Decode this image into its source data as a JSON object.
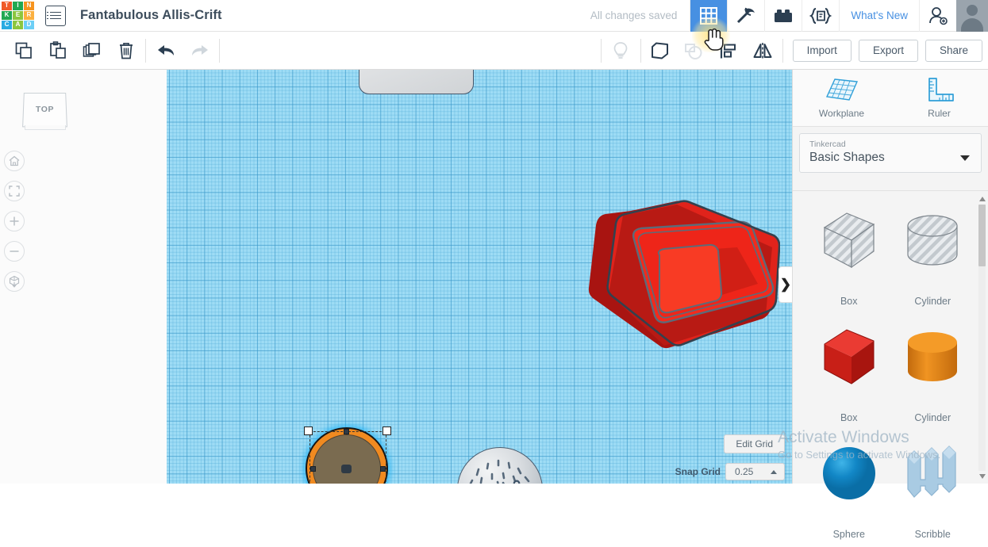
{
  "app": {
    "logo_letters": [
      "T",
      "I",
      "N",
      "K",
      "E",
      "R",
      "C",
      "A",
      "D"
    ],
    "logo_colors": [
      "#f05a28",
      "#22a852",
      "#f7941e",
      "#22a852",
      "#8cc63f",
      "#fbb040",
      "#29abe2",
      "#8cc63f",
      "#6dcff6"
    ],
    "project_title": "Fantabulous Allis-Crift",
    "menu_icon": "hamburger-list-icon"
  },
  "topbar": {
    "save_status": "All changes saved",
    "icons": [
      {
        "name": "blocks-grid-icon",
        "active": true
      },
      {
        "name": "pickaxe-minecraft-icon",
        "active": false
      },
      {
        "name": "lego-brick-icon",
        "active": false
      },
      {
        "name": "codeblocks-icon",
        "active": false
      }
    ],
    "whats_new": "What's New",
    "invite_icon": "add-person-icon",
    "avatar_icon": "user-avatar"
  },
  "toolbar": {
    "left_icons": [
      {
        "name": "copy-icon",
        "enabled": true
      },
      {
        "name": "paste-icon",
        "enabled": true
      },
      {
        "name": "duplicate-icon",
        "enabled": true
      },
      {
        "name": "delete-trash-icon",
        "enabled": true
      },
      {
        "name": "undo-icon",
        "enabled": true
      },
      {
        "name": "redo-icon",
        "enabled": false
      }
    ],
    "right_icons": [
      {
        "name": "lightbulb-icon",
        "enabled": false
      },
      {
        "name": "group-icon",
        "enabled": true
      },
      {
        "name": "ungroup-icon",
        "enabled": false
      },
      {
        "name": "align-icon",
        "enabled": true
      },
      {
        "name": "mirror-icon",
        "enabled": true
      }
    ],
    "import_label": "Import",
    "export_label": "Export",
    "share_label": "Share"
  },
  "viewport": {
    "view_cube_label": "TOP",
    "nav_buttons": [
      {
        "name": "home-view-icon"
      },
      {
        "name": "fit-to-view-icon"
      },
      {
        "name": "zoom-in-icon"
      },
      {
        "name": "zoom-out-icon"
      },
      {
        "name": "perspective-toggle-icon"
      }
    ],
    "edit_grid_label": "Edit Grid",
    "snap_grid_label": "Snap Grid",
    "snap_grid_value": "0.25",
    "collapse_arrow": "❯",
    "objects": [
      {
        "name": "gray-rounded-box",
        "color": "#d8dbde",
        "selected": false
      },
      {
        "name": "red-hollow-box",
        "color": "#e8231c",
        "selected": false
      },
      {
        "name": "gray-textured-sphere",
        "color": "#c3c9cf",
        "selected": false
      },
      {
        "name": "orange-cylinder-with-hole",
        "color": "#f08a20",
        "hole_color": "#7a6b50",
        "selected": true
      }
    ],
    "grid_color": "#9edcf5",
    "selection_color": "#29b6f6"
  },
  "right_panel": {
    "tools": [
      {
        "name": "workplane-icon",
        "label": "Workplane"
      },
      {
        "name": "ruler-icon",
        "label": "Ruler"
      }
    ],
    "library": {
      "owner": "Tinkercad",
      "collection": "Basic Shapes"
    },
    "shapes": [
      {
        "label": "Box",
        "variant": "hole",
        "color": "#cfd4d8"
      },
      {
        "label": "Cylinder",
        "variant": "hole",
        "color": "#cfd4d8"
      },
      {
        "label": "Box",
        "variant": "solid",
        "color": "#d81e1e"
      },
      {
        "label": "Cylinder",
        "variant": "solid",
        "color": "#ef8b1f"
      },
      {
        "label": "Sphere",
        "variant": "solid",
        "color": "#1585c4"
      },
      {
        "label": "Scribble",
        "variant": "solid",
        "color": "#a9c9e0"
      }
    ]
  },
  "watermark": {
    "line1": "Activate Windows",
    "line2": "Go to Settings to activate Windows."
  },
  "colors": {
    "accent": "#4790e2",
    "text_dark": "#3d4d5c",
    "grid_blue": "#9edcf5"
  }
}
